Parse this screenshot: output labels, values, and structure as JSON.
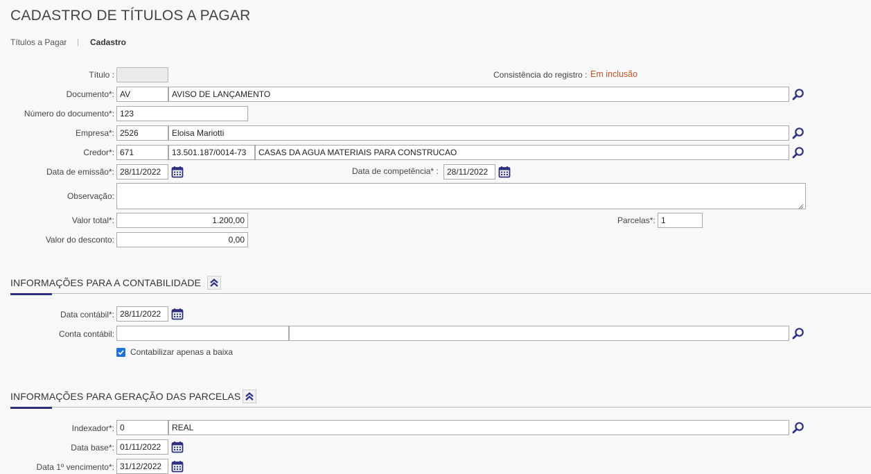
{
  "page": {
    "title": "CADASTRO DE TÍTULOS A PAGAR"
  },
  "breadcrumb": {
    "parent": "Títulos a Pagar",
    "separator": "|",
    "current": "Cadastro"
  },
  "form": {
    "titulo_label": "Título :",
    "titulo_value": "",
    "consistencia_label": "Consistência do registro :",
    "consistencia_value": "Em inclusão",
    "documento_label": "Documento*:",
    "documento_code": "AV",
    "documento_desc": "AVISO DE LANÇAMENTO",
    "numero_label": "Número do documento*:",
    "numero_value": "123",
    "empresa_label": "Empresa*:",
    "empresa_code": "2526",
    "empresa_desc": "Eloisa Mariotti",
    "credor_label": "Credor*:",
    "credor_code": "671",
    "credor_cnpj": "13.501.187/0014-73",
    "credor_desc": "CASAS DA AGUA MATERIAIS PARA CONSTRUCAO",
    "emissao_label": "Data de emissão*:",
    "emissao_value": "28/11/2022",
    "competencia_label": "Data de competência* :",
    "competencia_value": "28/11/2022",
    "observacao_label": "Observação:",
    "observacao_value": "",
    "valor_total_label": "Valor total*:",
    "valor_total_value": "1.200,00",
    "parcelas_label": "Parcelas*:",
    "parcelas_value": "1",
    "desconto_label": "Valor do desconto:",
    "desconto_value": "0,00"
  },
  "contabilidade": {
    "title": "INFORMAÇÕES PARA A CONTABILIDADE",
    "data_label": "Data contábil*:",
    "data_value": "28/11/2022",
    "conta_label": "Conta contábil:",
    "conta_code": "",
    "conta_desc": "",
    "contabilizar_label": "Contabilizar apenas a baixa",
    "contabilizar_checked": true
  },
  "parcelas_section": {
    "title": "INFORMAÇÕES PARA GERAÇÃO DAS PARCELAS",
    "indexador_label": "Indexador*:",
    "indexador_code": "0",
    "indexador_desc": "REAL",
    "data_base_label": "Data base*:",
    "data_base_value": "01/11/2022",
    "vencimento_label": "Data 1º vencimento*:",
    "vencimento_value": "31/12/2022"
  },
  "colors": {
    "accent": "#2d2f80",
    "status": "#c0542b",
    "icon": "#2d2f80",
    "checkbox": "#1e73d8"
  },
  "icons": [
    "search-icon",
    "calendar-icon",
    "chevron-double-up-icon",
    "check-icon"
  ]
}
